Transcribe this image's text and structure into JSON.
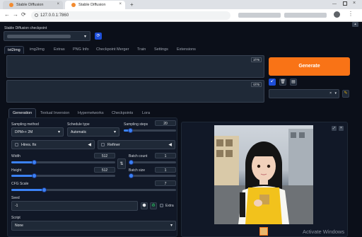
{
  "browser": {
    "tabs": [
      {
        "label": "Stable Diffusion"
      },
      {
        "label": "Stable Diffusion"
      }
    ],
    "new_tab": "+",
    "url": "127.0.0.1:7860",
    "nav": {
      "back": "←",
      "forward": "→",
      "reload": "⟳"
    }
  },
  "header": {
    "checkpoint_label": "Stable Diffusion checkpoint",
    "refresh": "⟳",
    "collapse": "▲"
  },
  "main_tabs": [
    "txt2img",
    "img2img",
    "Extras",
    "PNG Info",
    "Checkpoint Merger",
    "Train",
    "Settings",
    "Extensions"
  ],
  "prompt": {
    "token_count": "2/75"
  },
  "negative_prompt": {
    "token_count": "0/75"
  },
  "generate_label": "Generate",
  "sub_tabs": [
    "Generation",
    "Textual Inversion",
    "Hypernetworks",
    "Checkpoints",
    "Lora"
  ],
  "generation": {
    "sampling_method_label": "Sampling method",
    "sampling_method_value": "DPM++ 2M",
    "schedule_type_label": "Schedule type",
    "schedule_type_value": "Automatic",
    "sampling_steps_label": "Sampling steps",
    "sampling_steps_value": "20",
    "sampling_steps_fraction": 0.13,
    "hires_fix_label": "Hires. fix",
    "refiner_label": "Refiner",
    "width_label": "Width",
    "width_value": "512",
    "width_fraction": 0.22,
    "height_label": "Height",
    "height_value": "512",
    "height_fraction": 0.22,
    "swap_icon": "⇅",
    "batch_count_label": "Batch count",
    "batch_count_value": "1",
    "batch_count_fraction": 0.0,
    "batch_size_label": "Batch size",
    "batch_size_value": "1",
    "batch_size_fraction": 0.0,
    "cfg_label": "CFG Scale",
    "cfg_value": "7",
    "cfg_fraction": 0.2,
    "seed_label": "Seed",
    "seed_value": "-1",
    "extra_label": "Extra",
    "script_label": "Script",
    "script_value": "None"
  },
  "output": {
    "close": "×"
  },
  "watermark": "Activate Windows",
  "colors": {
    "accent": "#f97316",
    "slider": "#3b82f6",
    "background": "#0b0f19"
  }
}
